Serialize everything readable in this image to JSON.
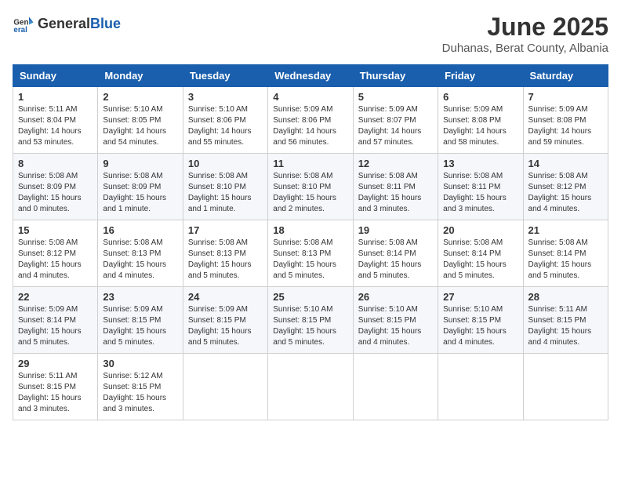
{
  "header": {
    "logo_general": "General",
    "logo_blue": "Blue",
    "month_title": "June 2025",
    "location": "Duhanas, Berat County, Albania"
  },
  "weekdays": [
    "Sunday",
    "Monday",
    "Tuesday",
    "Wednesday",
    "Thursday",
    "Friday",
    "Saturday"
  ],
  "weeks": [
    [
      {
        "day": "1",
        "sunrise": "5:11 AM",
        "sunset": "8:04 PM",
        "daylight": "14 hours and 53 minutes."
      },
      {
        "day": "2",
        "sunrise": "5:10 AM",
        "sunset": "8:05 PM",
        "daylight": "14 hours and 54 minutes."
      },
      {
        "day": "3",
        "sunrise": "5:10 AM",
        "sunset": "8:06 PM",
        "daylight": "14 hours and 55 minutes."
      },
      {
        "day": "4",
        "sunrise": "5:09 AM",
        "sunset": "8:06 PM",
        "daylight": "14 hours and 56 minutes."
      },
      {
        "day": "5",
        "sunrise": "5:09 AM",
        "sunset": "8:07 PM",
        "daylight": "14 hours and 57 minutes."
      },
      {
        "day": "6",
        "sunrise": "5:09 AM",
        "sunset": "8:08 PM",
        "daylight": "14 hours and 58 minutes."
      },
      {
        "day": "7",
        "sunrise": "5:09 AM",
        "sunset": "8:08 PM",
        "daylight": "14 hours and 59 minutes."
      }
    ],
    [
      {
        "day": "8",
        "sunrise": "5:08 AM",
        "sunset": "8:09 PM",
        "daylight": "15 hours and 0 minutes."
      },
      {
        "day": "9",
        "sunrise": "5:08 AM",
        "sunset": "8:09 PM",
        "daylight": "15 hours and 1 minute."
      },
      {
        "day": "10",
        "sunrise": "5:08 AM",
        "sunset": "8:10 PM",
        "daylight": "15 hours and 1 minute."
      },
      {
        "day": "11",
        "sunrise": "5:08 AM",
        "sunset": "8:10 PM",
        "daylight": "15 hours and 2 minutes."
      },
      {
        "day": "12",
        "sunrise": "5:08 AM",
        "sunset": "8:11 PM",
        "daylight": "15 hours and 3 minutes."
      },
      {
        "day": "13",
        "sunrise": "5:08 AM",
        "sunset": "8:11 PM",
        "daylight": "15 hours and 3 minutes."
      },
      {
        "day": "14",
        "sunrise": "5:08 AM",
        "sunset": "8:12 PM",
        "daylight": "15 hours and 4 minutes."
      }
    ],
    [
      {
        "day": "15",
        "sunrise": "5:08 AM",
        "sunset": "8:12 PM",
        "daylight": "15 hours and 4 minutes."
      },
      {
        "day": "16",
        "sunrise": "5:08 AM",
        "sunset": "8:13 PM",
        "daylight": "15 hours and 4 minutes."
      },
      {
        "day": "17",
        "sunrise": "5:08 AM",
        "sunset": "8:13 PM",
        "daylight": "15 hours and 5 minutes."
      },
      {
        "day": "18",
        "sunrise": "5:08 AM",
        "sunset": "8:13 PM",
        "daylight": "15 hours and 5 minutes."
      },
      {
        "day": "19",
        "sunrise": "5:08 AM",
        "sunset": "8:14 PM",
        "daylight": "15 hours and 5 minutes."
      },
      {
        "day": "20",
        "sunrise": "5:08 AM",
        "sunset": "8:14 PM",
        "daylight": "15 hours and 5 minutes."
      },
      {
        "day": "21",
        "sunrise": "5:08 AM",
        "sunset": "8:14 PM",
        "daylight": "15 hours and 5 minutes."
      }
    ],
    [
      {
        "day": "22",
        "sunrise": "5:09 AM",
        "sunset": "8:14 PM",
        "daylight": "15 hours and 5 minutes."
      },
      {
        "day": "23",
        "sunrise": "5:09 AM",
        "sunset": "8:15 PM",
        "daylight": "15 hours and 5 minutes."
      },
      {
        "day": "24",
        "sunrise": "5:09 AM",
        "sunset": "8:15 PM",
        "daylight": "15 hours and 5 minutes."
      },
      {
        "day": "25",
        "sunrise": "5:10 AM",
        "sunset": "8:15 PM",
        "daylight": "15 hours and 5 minutes."
      },
      {
        "day": "26",
        "sunrise": "5:10 AM",
        "sunset": "8:15 PM",
        "daylight": "15 hours and 4 minutes."
      },
      {
        "day": "27",
        "sunrise": "5:10 AM",
        "sunset": "8:15 PM",
        "daylight": "15 hours and 4 minutes."
      },
      {
        "day": "28",
        "sunrise": "5:11 AM",
        "sunset": "8:15 PM",
        "daylight": "15 hours and 4 minutes."
      }
    ],
    [
      {
        "day": "29",
        "sunrise": "5:11 AM",
        "sunset": "8:15 PM",
        "daylight": "15 hours and 3 minutes."
      },
      {
        "day": "30",
        "sunrise": "5:12 AM",
        "sunset": "8:15 PM",
        "daylight": "15 hours and 3 minutes."
      },
      null,
      null,
      null,
      null,
      null
    ]
  ]
}
